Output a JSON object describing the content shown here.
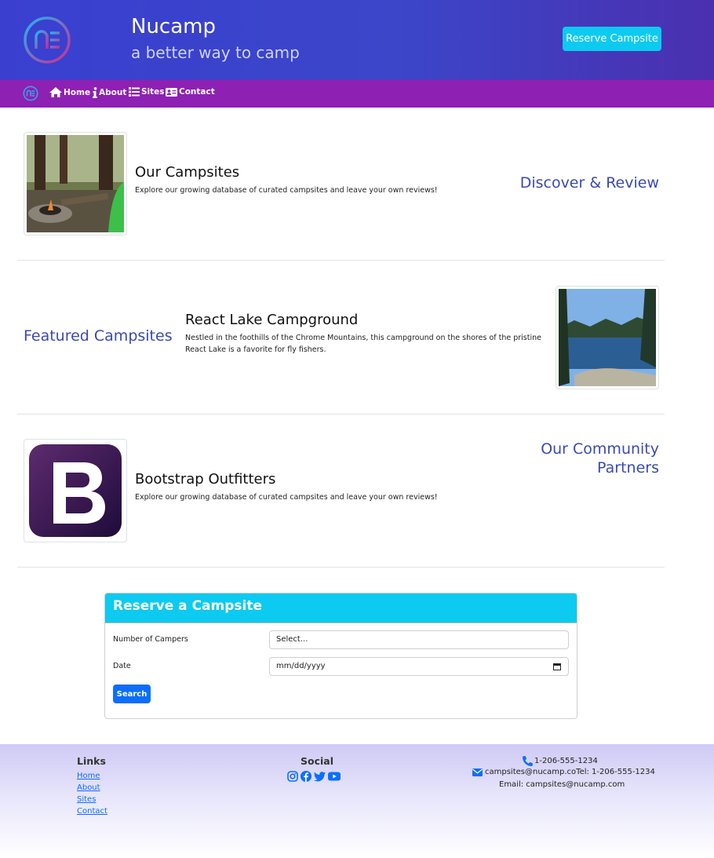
{
  "header": {
    "brand_title": "Nucamp",
    "brand_subtitle": "a better way to camp",
    "reserve_button": "Reserve Campsite"
  },
  "nav": {
    "items": [
      {
        "label": "Home",
        "icon": "home-icon"
      },
      {
        "label": "About",
        "icon": "info-icon"
      },
      {
        "label": "Sites",
        "icon": "list-icon"
      },
      {
        "label": "Contact",
        "icon": "address-card-icon"
      }
    ]
  },
  "sections": [
    {
      "heading": "Discover & Review",
      "title": "Our Campsites",
      "text": "Explore our growing database of curated campsites and leave your own reviews!"
    },
    {
      "heading": "Featured Campsites",
      "title": "React Lake Campground",
      "text": "Nestled in the foothills of the Chrome Mountains, this campground on the shores of the pristine React Lake is a favorite for fly fishers."
    },
    {
      "heading_line1": "Our Community",
      "heading_line2": "Partners",
      "title": "Bootstrap Outfitters",
      "text": "Explore our growing database of curated campsites and leave your own reviews!"
    }
  ],
  "reserve_form": {
    "title": "Reserve a Campsite",
    "campers_label": "Number of Campers",
    "campers_value": "Select...",
    "date_label": "Date",
    "date_placeholder": "mm/dd/yyyy",
    "search_button": "Search"
  },
  "footer": {
    "links_heading": "Links",
    "links": [
      "Home",
      "About",
      "Sites",
      "Contact"
    ],
    "social_heading": "Social",
    "social_icons": [
      "instagram-icon",
      "facebook-icon",
      "twitter-icon",
      "youtube-icon"
    ],
    "phone": "1-206-555-1234",
    "email_line": "campsites@nucamp.coTel: 1-206-555-1234",
    "email_plain": "Email: campsites@nucamp.com"
  },
  "colors": {
    "header_gradient": "#3a3fd0",
    "navbar": "#8e20b3",
    "accent_info": "#0dcaf0",
    "primary": "#0d6efd",
    "heading_blue": "#3b4ab0"
  }
}
